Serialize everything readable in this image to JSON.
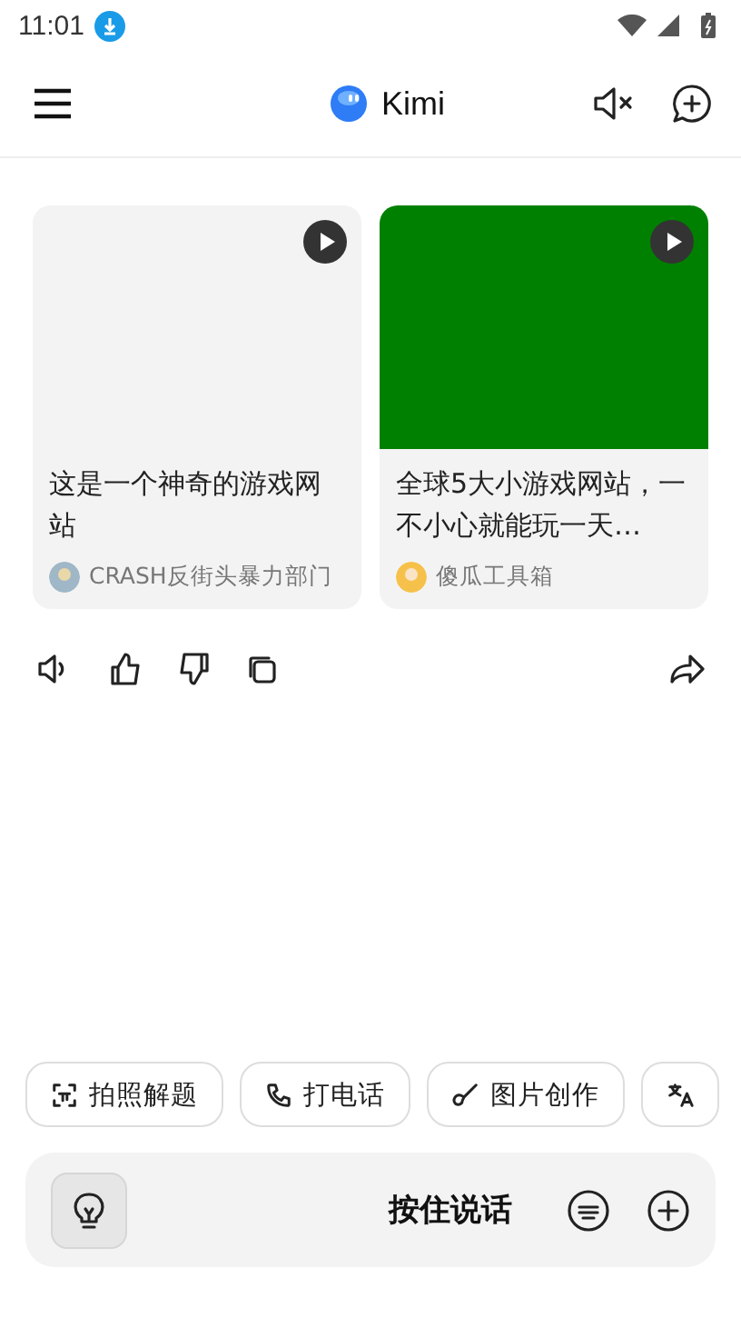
{
  "status_bar": {
    "time": "11:01"
  },
  "header": {
    "title": "Kimi"
  },
  "cards": [
    {
      "title": "这是一个神奇的游戏网站",
      "author": "CRASH反街头暴力部门",
      "color": "#f3f3f3"
    },
    {
      "title": "全球5大小游戏网站，一不小心就能玩一天…",
      "author": "傻瓜工具箱",
      "color": "#008000"
    }
  ],
  "chips": [
    {
      "kind": "photo",
      "label": "拍照解题"
    },
    {
      "kind": "call",
      "label": "打电话"
    },
    {
      "kind": "image",
      "label": "图片创作"
    },
    {
      "kind": "translate"
    }
  ],
  "input": {
    "label": "按住说话"
  }
}
